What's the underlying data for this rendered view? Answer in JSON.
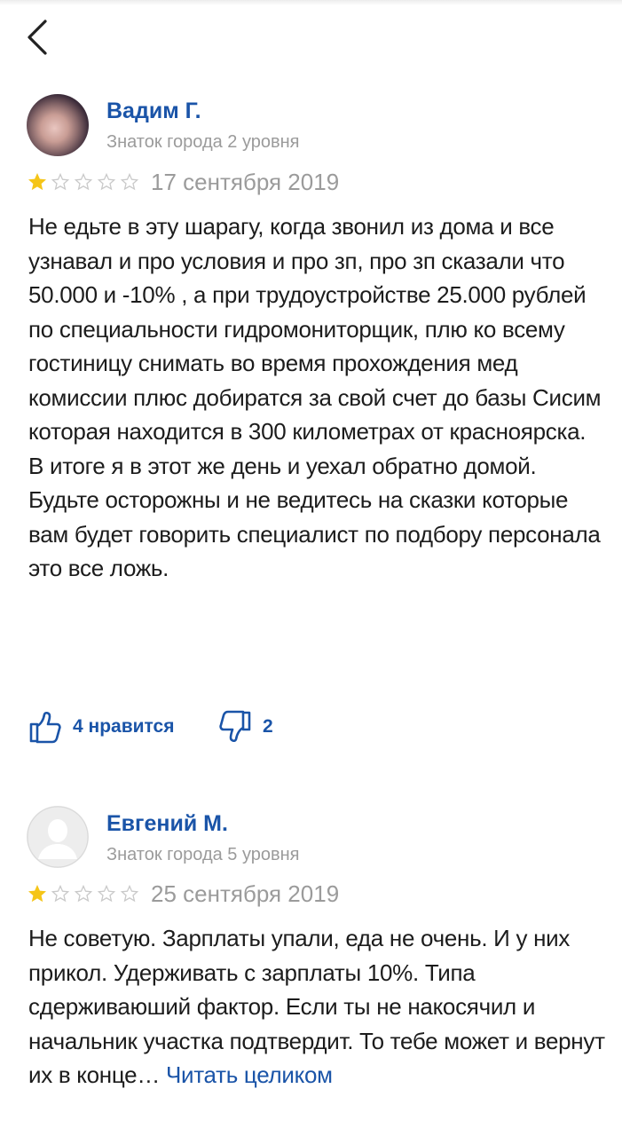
{
  "header": {
    "back_icon": "chevron-left-icon"
  },
  "colors": {
    "link": "#1a54a8",
    "muted": "#9b9b9b",
    "star_on": "#f5c518",
    "star_off": "#d0d0d0"
  },
  "reviews": [
    {
      "author": "Вадим Г.",
      "level": "Знаток города 2 уровня",
      "rating": 1,
      "max_rating": 5,
      "date": "17 сентября 2019",
      "text": "Не едьте в эту шарагу, когда звонил из дома и все узнавал и про условия и про зп, про зп сказали что 50.000 и -10% , а при трудоустройстве 25.000 рублей по специальности гидромониторщик, плю ко всему гостиницу снимать во время прохождения мед комиссии плюс добиратся за свой счет до базы Сисим которая находится в 300 километрах от красноярска. В итоге я в этот же день и уехал обратно домой. Будьте осторожны и не ведитесь на сказки которые вам будет говорить специалист по подбору персонала это все ложь.",
      "likes_label": "4 нравится",
      "dislikes": "2"
    },
    {
      "author": "Евгений М.",
      "level": "Знаток города 5 уровня",
      "rating": 1,
      "max_rating": 5,
      "date": "25 сентября 2019",
      "text": "Не советую. Зарплаты упали, еда не очень. И у них прикол. Удерживать с зарплаты 10%. Типа сдерживаюший фактор. Если ты не накосячил и начальник участка подтвердит. То тебе может и вернут их в конце…",
      "read_more": "Читать целиком"
    }
  ]
}
